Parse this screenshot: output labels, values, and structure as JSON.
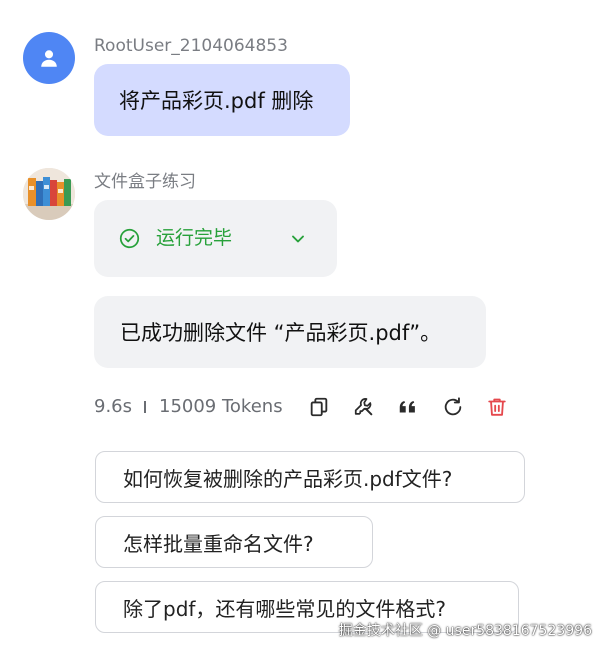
{
  "user_message": {
    "username": "RootUser_2104064853",
    "text": "将产品彩页.pdf 删除"
  },
  "bot_message": {
    "bot_name": "文件盒子练习",
    "status": "运行完毕",
    "reply": "已成功删除文件 “产品彩页.pdf”。"
  },
  "meta": {
    "duration": "9.6s",
    "tokens": "15009 Tokens"
  },
  "actions": {
    "icons": [
      "copy-icon",
      "wrench-icon",
      "quote-icon",
      "refresh-icon",
      "trash-icon"
    ],
    "delete_color": "#e5484d"
  },
  "suggestions": [
    "如何恢复被删除的产品彩页.pdf文件?",
    "怎样批量重命名文件?",
    "除了pdf，还有哪些常见的文件格式?"
  ],
  "watermark": "掘金技术社区 @ user5838167523996",
  "colors": {
    "user_bubble": "#d4dbff",
    "bot_bubble": "#f1f2f4",
    "status_green": "#27a13a",
    "user_avatar": "#4f86f4"
  }
}
